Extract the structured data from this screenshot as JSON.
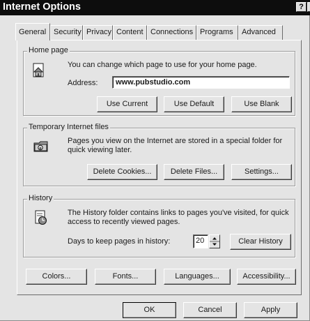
{
  "window": {
    "title": "Internet Options",
    "help_glyph": "?",
    "close_glyph": "×"
  },
  "tabs": [
    {
      "label": "General"
    },
    {
      "label": "Security"
    },
    {
      "label": "Privacy"
    },
    {
      "label": "Content"
    },
    {
      "label": "Connections"
    },
    {
      "label": "Programs"
    },
    {
      "label": "Advanced"
    }
  ],
  "home_page": {
    "label": "Home page",
    "description": "You can change which page to use for your home page.",
    "address_label": "Address:",
    "address_value": "www.pubstudio.com",
    "icon": "home-page-icon",
    "buttons": {
      "use_current": "Use Current",
      "use_default": "Use Default",
      "use_blank": "Use Blank"
    }
  },
  "temp_files": {
    "label": "Temporary Internet files",
    "description_line1": "Pages you view on the Internet are stored in a special folder for",
    "description_line2": "quick viewing later.",
    "icon": "temporary-files-icon",
    "buttons": {
      "delete_cookies": "Delete Cookies...",
      "delete_files": "Delete Files...",
      "settings": "Settings..."
    }
  },
  "history": {
    "label": "History",
    "description_line1": "The History folder contains links to pages you've visited, for quick",
    "description_line2": "access to recently viewed pages.",
    "days_label": "Days to keep pages in history:",
    "days_value": "20",
    "icon": "history-icon",
    "clear_button": "Clear History"
  },
  "bottom_buttons": {
    "colors": "Colors...",
    "fonts": "Fonts...",
    "languages": "Languages...",
    "accessibility": "Accessibility..."
  },
  "dialog_buttons": {
    "ok": "OK",
    "cancel": "Cancel",
    "apply": "Apply"
  }
}
